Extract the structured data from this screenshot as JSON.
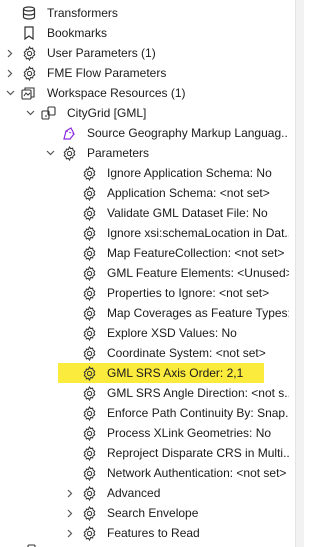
{
  "tree": {
    "transformers": "Transformers",
    "bookmarks": "Bookmarks",
    "user_parameters": "User Parameters (1)",
    "fme_flow_parameters": "FME Flow Parameters",
    "workspace_resources": "Workspace Resources (1)",
    "citygrid": "CityGrid [GML]",
    "source_geography": "Source Geography Markup Languag...",
    "parameters": "Parameters",
    "params": [
      "Ignore Application Schema: No",
      "Application Schema: <not set>",
      "Validate GML Dataset File: No",
      "Ignore xsi:schemaLocation in Dat...",
      "Map FeatureCollection: <not set>",
      "GML Feature Elements: <Unused>",
      "Properties to Ignore: <not set>",
      "Map Coverages as Feature Types:...",
      "Explore XSD Values: No",
      "Coordinate System: <not set>",
      "GML SRS Axis Order: 2,1",
      "GML SRS Angle Direction: <not s...",
      "Enforce Path Continuity By: Snap...",
      "Process XLink Geometries: No",
      "Reproject Disparate CRS in Multi...",
      "Network Authentication: <not set>"
    ],
    "advanced": "Advanced",
    "search_envelope": "Search Envelope",
    "features_to_read": "Features to Read"
  },
  "highlight_color": "#fbeb3c"
}
